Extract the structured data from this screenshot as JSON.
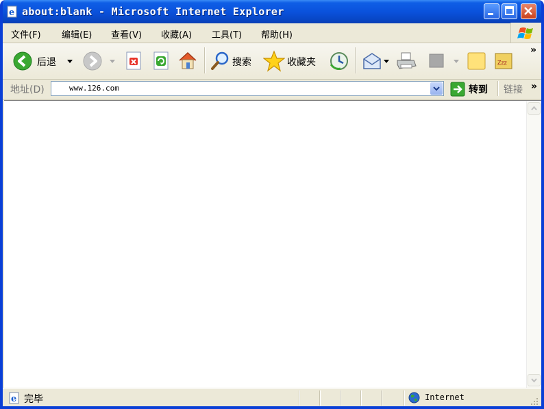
{
  "window": {
    "title": "about:blank - Microsoft Internet Explorer"
  },
  "menu": {
    "items": [
      "文件(F)",
      "编辑(E)",
      "查看(V)",
      "收藏(A)",
      "工具(T)",
      "帮助(H)"
    ]
  },
  "toolbar": {
    "back_label": "后退",
    "search_label": "搜索",
    "favorites_label": "收藏夹",
    "more_label": "»"
  },
  "address": {
    "label": "地址(D)",
    "value": "www.126.com",
    "go_label": "转到",
    "links_label": "链接",
    "links_more": "»"
  },
  "status": {
    "text": "完毕",
    "zone": "Internet"
  },
  "colors": {
    "titlebar": "#0a52dc",
    "chrome": "#ece9d8",
    "back_green": "#3aa832"
  }
}
